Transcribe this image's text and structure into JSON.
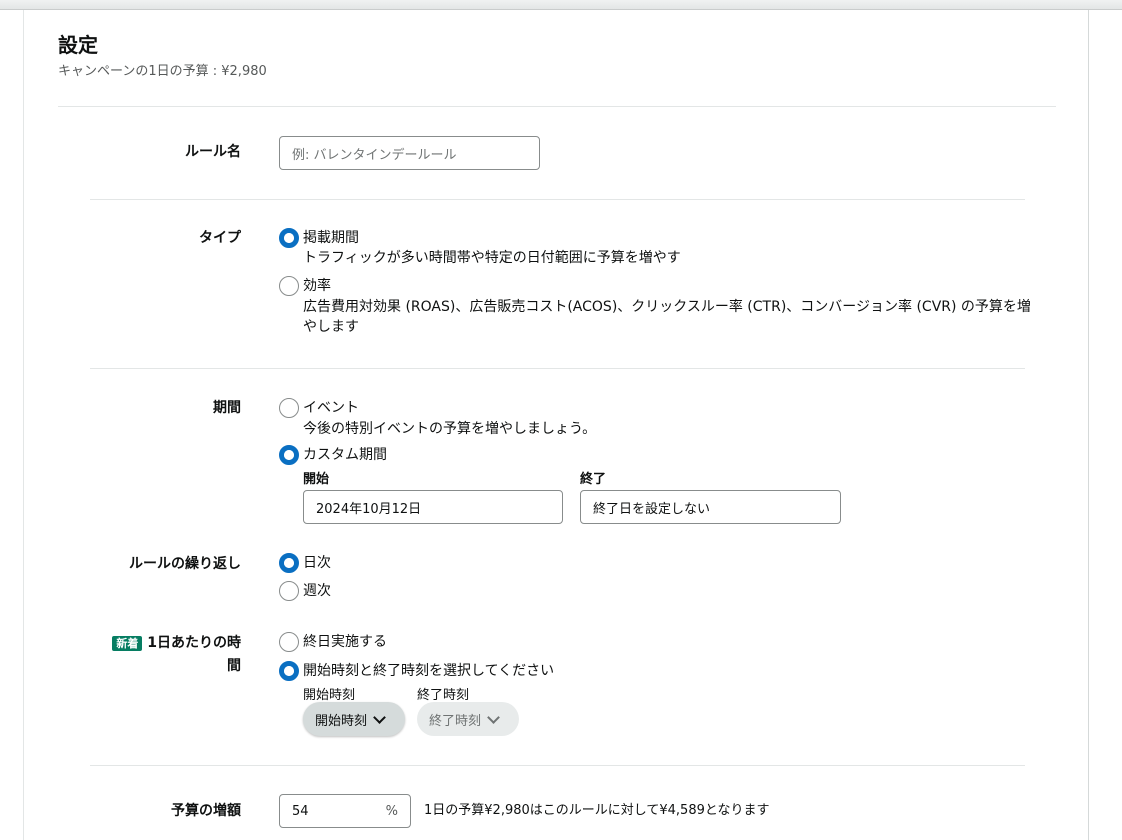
{
  "page": {
    "title": "設定",
    "subtitle": "キャンペーンの1日の予算 : ¥2,980"
  },
  "rule_name": {
    "label": "ルール名",
    "placeholder": "例: バレンタインデールール"
  },
  "type": {
    "label": "タイプ",
    "options": [
      {
        "label": "掲載期間",
        "description": "トラフィックが多い時間帯や特定の日付範囲に予算を増やす",
        "selected": true
      },
      {
        "label": "効率",
        "description_line1": "広告費用対効果 (ROAS)、広告販売コスト(ACOS)、クリックスルー率 (CTR)、コンバージョン率 (CVR) の予算を増",
        "description_line2": "やします",
        "selected": false
      }
    ]
  },
  "period": {
    "label": "期間",
    "options": [
      {
        "label": "イベント",
        "description": "今後の特別イベントの予算を増やしましょう。",
        "selected": false
      },
      {
        "label": "カスタム期間",
        "selected": true
      }
    ],
    "start_label": "開始",
    "start_value": "2024年10月12日",
    "end_label": "終了",
    "end_value": "終了日を設定しない"
  },
  "repeat": {
    "label": "ルールの繰り返し",
    "options": [
      {
        "label": "日次",
        "selected": true
      },
      {
        "label": "週次",
        "selected": false
      }
    ]
  },
  "time_of_day": {
    "badge": "新着",
    "label_line1": "1日あたりの時",
    "label_line2": "間",
    "options": [
      {
        "label": "終日実施する",
        "selected": false
      },
      {
        "label": "開始時刻と終了時刻を選択してください",
        "selected": true
      }
    ],
    "start_time_label": "開始時刻",
    "start_time_button": "開始時刻",
    "end_time_label": "終了時刻",
    "end_time_button": "終了時刻"
  },
  "budget_increase": {
    "label": "予算の増額",
    "value": "54",
    "unit": "%",
    "note": "1日の予算¥2,980はこのルールに対して¥4,589となります"
  },
  "colors": {
    "radio_selected": "#0a6fc2",
    "badge": "#067d62"
  }
}
